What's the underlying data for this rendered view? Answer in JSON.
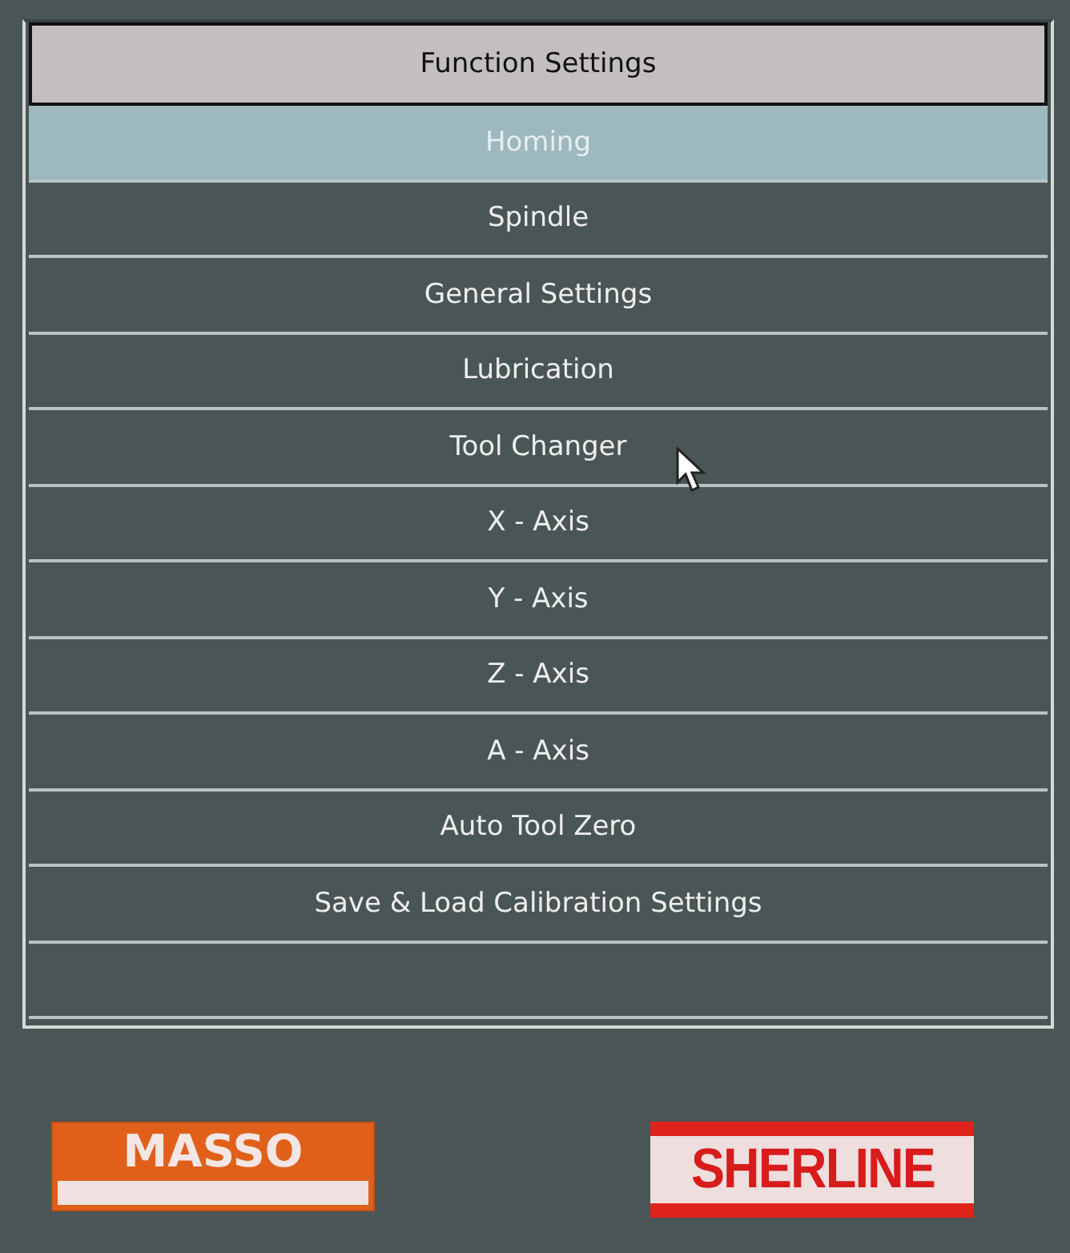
{
  "header": {
    "title": "Function Settings"
  },
  "menu": [
    {
      "label": "Homing",
      "selected": true
    },
    {
      "label": "Spindle",
      "selected": false
    },
    {
      "label": "General Settings",
      "selected": false
    },
    {
      "label": "Lubrication",
      "selected": false
    },
    {
      "label": "Tool Changer",
      "selected": false
    },
    {
      "label": "X - Axis",
      "selected": false
    },
    {
      "label": "Y - Axis",
      "selected": false
    },
    {
      "label": "Z - Axis",
      "selected": false
    },
    {
      "label": "A - Axis",
      "selected": false
    },
    {
      "label": "Auto Tool Zero",
      "selected": false
    },
    {
      "label": "Save & Load Calibration Settings",
      "selected": false
    }
  ],
  "logos": [
    {
      "kind": "masso",
      "text": "MASSO"
    },
    {
      "kind": "sherline",
      "text": "SHERLINE"
    }
  ]
}
